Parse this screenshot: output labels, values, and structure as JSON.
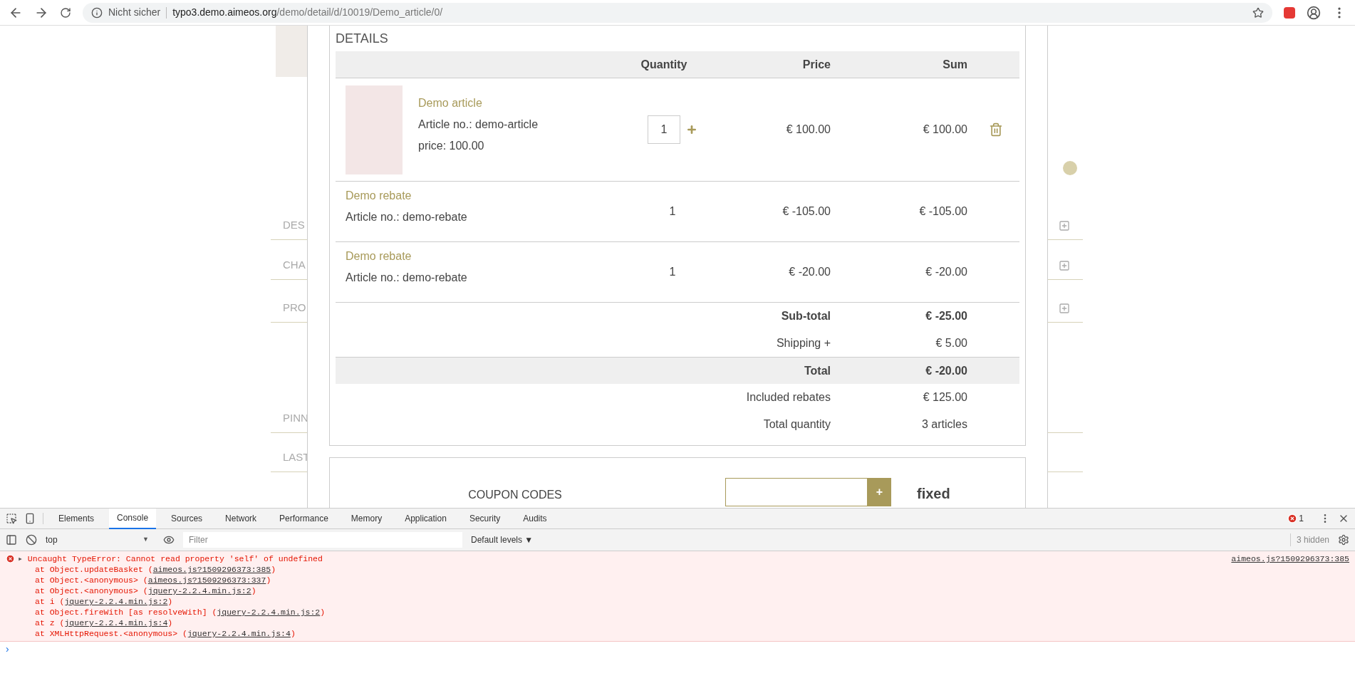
{
  "browser": {
    "security": "Nicht sicher",
    "url_host": "typo3.demo.aimeos.org",
    "url_path": "/demo/detail/d/10019/Demo_article/0/"
  },
  "background_sections": [
    {
      "label": "DES",
      "expandable": true
    },
    {
      "label": "CHA",
      "expandable": true
    },
    {
      "label": "PRO",
      "expandable": true
    },
    {
      "label": "PINN",
      "expandable": false
    },
    {
      "label": "LAST",
      "expandable": false
    }
  ],
  "basket": {
    "heading": "DETAILS",
    "columns": [
      "Quantity",
      "Price",
      "Sum"
    ],
    "items": [
      {
        "kind": "product",
        "name": "Demo article",
        "article_no": "Article no.: demo-article",
        "unit_price": "price: 100.00",
        "quantity": "1",
        "price": "€ 100.00",
        "sum": "€ 100.00"
      },
      {
        "kind": "rebate",
        "name": "Demo rebate",
        "article_no": "Article no.: demo-rebate",
        "quantity": "1",
        "price": "€ -105.00",
        "sum": "€ -105.00"
      },
      {
        "kind": "rebate",
        "name": "Demo rebate",
        "article_no": "Article no.: demo-rebate",
        "quantity": "1",
        "price": "€ -20.00",
        "sum": "€ -20.00"
      }
    ],
    "totals": [
      {
        "label": "Sub-total",
        "value": "€ -25.00",
        "bold": true,
        "shaded": false
      },
      {
        "label": "Shipping +",
        "value": "€ 5.00",
        "bold": false,
        "shaded": false
      },
      {
        "label": "Total",
        "value": "€ -20.00",
        "bold": true,
        "shaded": true
      },
      {
        "label": "Included rebates",
        "value": "€ 125.00",
        "bold": false,
        "shaded": false
      },
      {
        "label": "Total quantity",
        "value": "3 articles",
        "bold": false,
        "shaded": false
      }
    ]
  },
  "coupon": {
    "label": "COUPON CODES",
    "button": "+",
    "status": "fixed"
  },
  "devtools": {
    "tabs": [
      {
        "label": "Elements",
        "selected": false
      },
      {
        "label": "Console",
        "selected": true
      },
      {
        "label": "Sources",
        "selected": false
      },
      {
        "label": "Network",
        "selected": false
      },
      {
        "label": "Performance",
        "selected": false
      },
      {
        "label": "Memory",
        "selected": false
      },
      {
        "label": "Application",
        "selected": false
      },
      {
        "label": "Security",
        "selected": false
      },
      {
        "label": "Audits",
        "selected": false
      }
    ],
    "error_count": "1",
    "context": "top",
    "context_caret": "▼",
    "expand_marker": "▸",
    "filter_placeholder": "Filter",
    "levels": "Default levels ▼",
    "hidden": "3 hidden",
    "error": {
      "message": "Uncaught TypeError: Cannot read property 'self' of undefined",
      "source": "aimeos.js?1509296373:385",
      "stack": [
        {
          "text": "at Object.updateBasket (",
          "link": "aimeos.js?1509296373:385",
          "after": ")"
        },
        {
          "text": "at Object.<anonymous> (",
          "link": "aimeos.js?1509296373:337",
          "after": ")"
        },
        {
          "text": "at Object.<anonymous> (",
          "link": "jquery-2.2.4.min.js:2",
          "after": ")"
        },
        {
          "text": "at i (",
          "link": "jquery-2.2.4.min.js:2",
          "after": ")"
        },
        {
          "text": "at Object.fireWith [as resolveWith] (",
          "link": "jquery-2.2.4.min.js:2",
          "after": ")"
        },
        {
          "text": "at z (",
          "link": "jquery-2.2.4.min.js:4",
          "after": ")"
        },
        {
          "text": "at XMLHttpRequest.<anonymous> (",
          "link": "jquery-2.2.4.min.js:4",
          "after": ")"
        }
      ]
    },
    "prompt": "›"
  }
}
